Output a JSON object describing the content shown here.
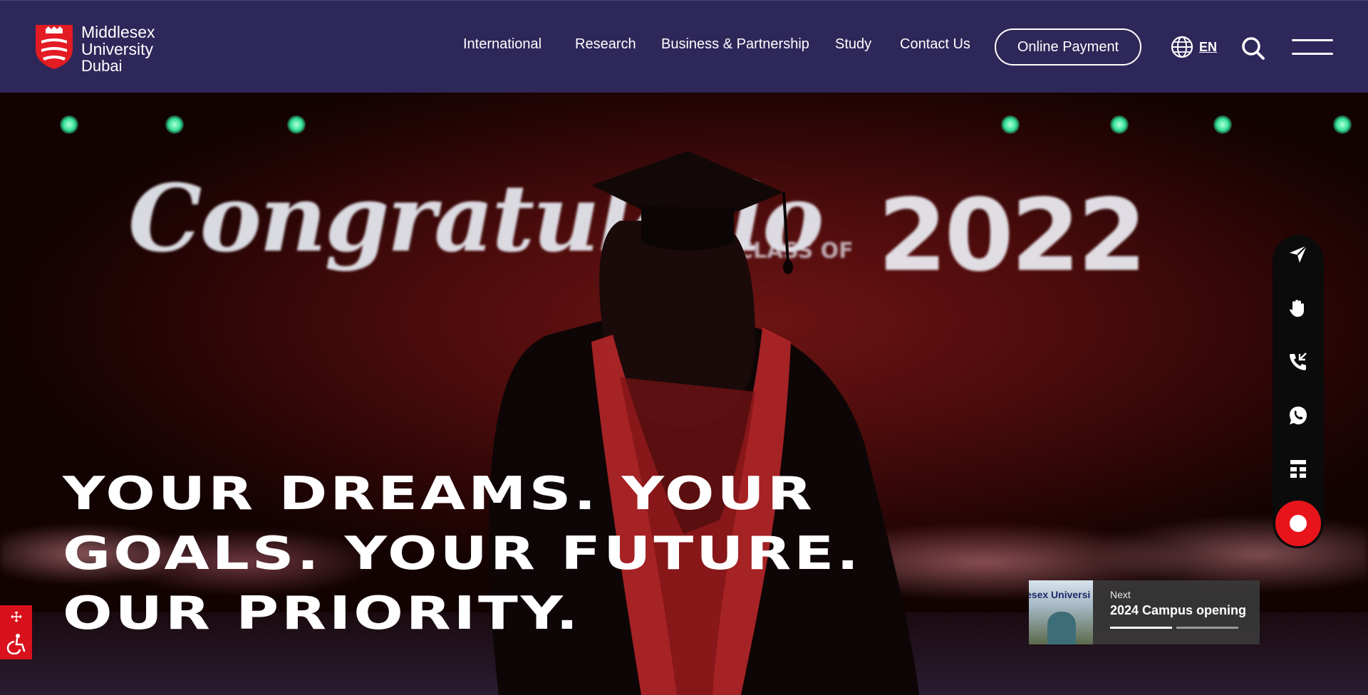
{
  "brand": {
    "line1": "Middlesex",
    "line2": "University",
    "line3": "Dubai"
  },
  "nav": {
    "items": [
      {
        "label": "International"
      },
      {
        "label": "Research"
      },
      {
        "label": "Business & Partnership"
      },
      {
        "label": "Study"
      },
      {
        "label": "Contact Us"
      }
    ],
    "payment_button": "Online Payment",
    "language": "EN",
    "icons": [
      "globe-icon",
      "search-icon",
      "hamburger-menu-icon"
    ]
  },
  "hero": {
    "background_text": "Congratulatio",
    "background_subtext": "CLASS OF",
    "background_year": "2022",
    "headline": [
      "YOUR DREAMS. YOUR",
      "GOALS. YOUR FUTURE.",
      "OUR PRIORITY."
    ]
  },
  "side_bar": {
    "icons": [
      "send-icon",
      "raised-hand-icon",
      "phone-callback-icon",
      "whatsapp-icon",
      "sitemap-icon"
    ],
    "chat_icon": "chat-bot-icon"
  },
  "next_slide": {
    "label": "Next",
    "title": "2024 Campus opening",
    "thumb_text": "esex Universi"
  },
  "accessibility": {
    "icons": [
      "move-arrows-icon",
      "wheelchair-icon"
    ]
  },
  "colors": {
    "header_bg": "#2e2759",
    "accent_red": "#e8141c",
    "sidebar_bg": "#0b0b0b"
  }
}
